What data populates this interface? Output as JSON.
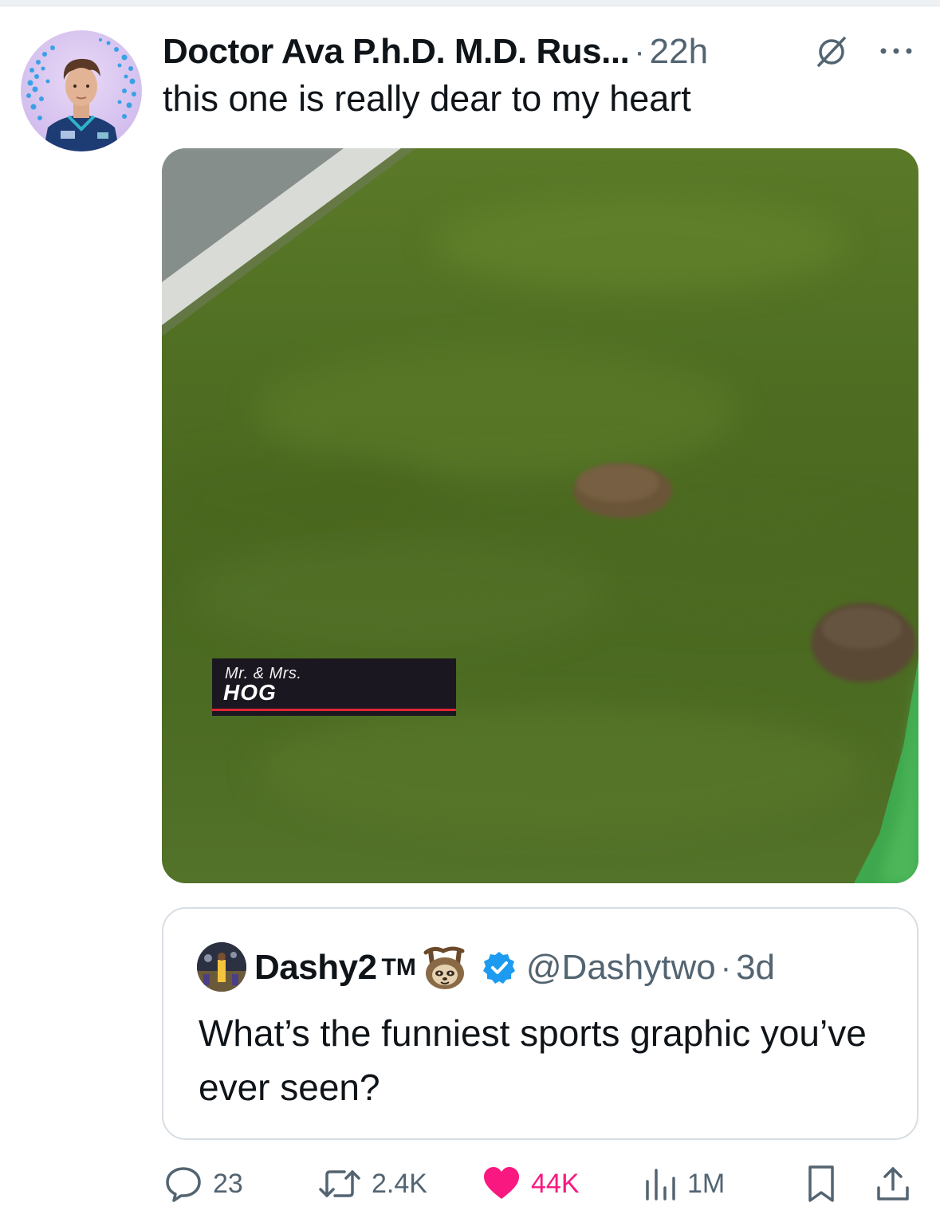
{
  "tweet": {
    "author_name": "Doctor Ava P.h.D. M.D. Rus...",
    "separator": "·",
    "time": "22h",
    "text": "this one is really dear to my heart",
    "media": {
      "lower_third_line1": "Mr. & Mrs.",
      "lower_third_line2": "HOG"
    }
  },
  "quoted_tweet": {
    "author_name": "Dashy2",
    "tm": "TM",
    "handle": "@Dashytwo",
    "separator": "·",
    "time": "3d",
    "text": "What’s the funniest sports graphic you’ve ever seen?"
  },
  "actions": {
    "replies": "23",
    "reposts": "2.4K",
    "likes": "44K",
    "views": "1M"
  },
  "colors": {
    "text_primary": "#0f1419",
    "text_secondary": "#536471",
    "like_pink": "#f91880",
    "verified_blue": "#1d9bf0",
    "border": "#d8dee3"
  },
  "icons": [
    "no-link-icon",
    "more-icon",
    "sloth-icon",
    "verified-icon",
    "reply-icon",
    "repost-icon",
    "like-icon",
    "views-icon",
    "bookmark-icon",
    "share-icon"
  ]
}
